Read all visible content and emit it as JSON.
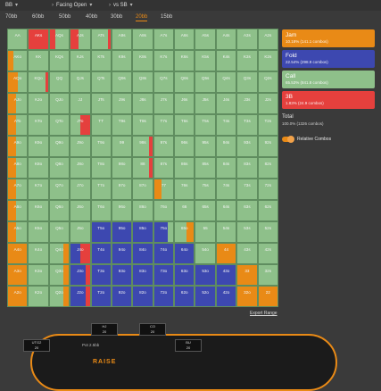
{
  "topbar": {
    "position": "BB",
    "situation": "Facing Open",
    "vs": "vs SB"
  },
  "stacks": [
    "70bb",
    "60bb",
    "50bb",
    "40bb",
    "30bb",
    "20bb",
    "15bb"
  ],
  "active_stack": "20bb",
  "colors": {
    "jam": "#e98a16",
    "fold": "#3d48b0",
    "call": "#8ec08a",
    "three_bet": "#e5403d",
    "accent": "#e98a16"
  },
  "actions": [
    {
      "key": "jam",
      "name": "Jam",
      "sub": "10.18% (141.1 combos)"
    },
    {
      "key": "fold",
      "name": "Fold",
      "sub": "22.54% (298.9 combos)"
    },
    {
      "key": "call",
      "name": "Call",
      "sub": "65.53% (841.8 combos)"
    },
    {
      "key": "three_bet",
      "name": "3B",
      "sub": "1.83% (24.9 combos)"
    }
  ],
  "total": {
    "label": "Total",
    "sub": "100.0% (1326 combos)"
  },
  "relative_combos_label": "Relative Combos",
  "export_label": "Export Range",
  "table": {
    "seats": [
      {
        "name": "HJ",
        "stack": "20"
      },
      {
        "name": "CO",
        "stack": "20"
      },
      {
        "name": "UTG2",
        "stack": "20"
      },
      {
        "name": "BU",
        "stack": "20"
      }
    ],
    "pot": "Pot 2.5bb",
    "logo": "RAISE"
  },
  "hands": [
    [
      "AA",
      "AKs",
      "AQs",
      "AJs",
      "ATs",
      "A9s",
      "A8s",
      "A7s",
      "A6s",
      "A5s",
      "A4s",
      "A3s",
      "A2s"
    ],
    [
      "AKo",
      "KK",
      "KQs",
      "KJs",
      "KTs",
      "K9s",
      "K8s",
      "K7s",
      "K6s",
      "K5s",
      "K4s",
      "K3s",
      "K2s"
    ],
    [
      "AQo",
      "KQo",
      "QQ",
      "QJs",
      "QTs",
      "Q9s",
      "Q8s",
      "Q7s",
      "Q6s",
      "Q5s",
      "Q4s",
      "Q3s",
      "Q2s"
    ],
    [
      "AJo",
      "KJo",
      "QJo",
      "JJ",
      "JTs",
      "J9s",
      "J8s",
      "J7s",
      "J6s",
      "J5s",
      "J4s",
      "J3s",
      "J2s"
    ],
    [
      "ATo",
      "KTo",
      "QTo",
      "JTo",
      "TT",
      "T9s",
      "T8s",
      "T7s",
      "T6s",
      "T5s",
      "T4s",
      "T3s",
      "T2s"
    ],
    [
      "A9o",
      "K9o",
      "Q9o",
      "J9o",
      "T9o",
      "99",
      "98s",
      "97s",
      "96s",
      "95s",
      "94s",
      "93s",
      "92s"
    ],
    [
      "A8o",
      "K8o",
      "Q8o",
      "J8o",
      "T8o",
      "98o",
      "88",
      "87s",
      "86s",
      "85s",
      "84s",
      "83s",
      "82s"
    ],
    [
      "A7o",
      "K7o",
      "Q7o",
      "J7o",
      "T7o",
      "97o",
      "87o",
      "77",
      "76s",
      "75s",
      "74s",
      "73s",
      "72s"
    ],
    [
      "A6o",
      "K6o",
      "Q6o",
      "J6o",
      "T6o",
      "96o",
      "86o",
      "76o",
      "66",
      "65s",
      "64s",
      "63s",
      "62s"
    ],
    [
      "A5o",
      "K5o",
      "Q5o",
      "J5o",
      "T5o",
      "95o",
      "85o",
      "75o",
      "65o",
      "55",
      "54s",
      "53s",
      "52s"
    ],
    [
      "A4o",
      "K4o",
      "Q4o",
      "J4o",
      "T4o",
      "94o",
      "84o",
      "74o",
      "64o",
      "54o",
      "44",
      "43s",
      "42s"
    ],
    [
      "A3o",
      "K3o",
      "Q3o",
      "J3o",
      "T3o",
      "93o",
      "83o",
      "73o",
      "63o",
      "53o",
      "43o",
      "33",
      "32s"
    ],
    [
      "A2o",
      "K2o",
      "Q2o",
      "J2o",
      "T2o",
      "92o",
      "82o",
      "72o",
      "62o",
      "52o",
      "42o",
      "32o",
      "22"
    ]
  ],
  "mix": [
    [
      [
        "c",
        1
      ],
      [
        "r",
        1
      ],
      [
        "r",
        0.3,
        "c",
        0.7
      ],
      [
        "r",
        0.4,
        "c",
        0.6
      ],
      [
        "c",
        0.85,
        "r",
        0.15
      ],
      [
        "c",
        1
      ],
      [
        "c",
        1
      ],
      [
        "c",
        1
      ],
      [
        "c",
        1
      ],
      [
        "c",
        1
      ],
      [
        "c",
        1
      ],
      [
        "c",
        1
      ],
      [
        "c",
        1
      ]
    ],
    [
      [
        "j",
        0.3,
        "c",
        0.7
      ],
      [
        "c",
        1
      ],
      [
        "c",
        1
      ],
      [
        "c",
        1
      ],
      [
        "c",
        1
      ],
      [
        "c",
        1
      ],
      [
        "c",
        1
      ],
      [
        "c",
        1
      ],
      [
        "c",
        1
      ],
      [
        "c",
        1
      ],
      [
        "c",
        1
      ],
      [
        "c",
        1
      ],
      [
        "c",
        1
      ]
    ],
    [
      [
        "j",
        0.5,
        "c",
        0.5
      ],
      [
        "c",
        0.85,
        "r",
        0.15
      ],
      [
        "c",
        1
      ],
      [
        "c",
        1
      ],
      [
        "c",
        1
      ],
      [
        "c",
        1
      ],
      [
        "c",
        1
      ],
      [
        "c",
        1
      ],
      [
        "c",
        1
      ],
      [
        "c",
        1
      ],
      [
        "c",
        1
      ],
      [
        "c",
        1
      ],
      [
        "c",
        1
      ]
    ],
    [
      [
        "j",
        0.4,
        "c",
        0.6
      ],
      [
        "c",
        1
      ],
      [
        "c",
        1
      ],
      [
        "c",
        1
      ],
      [
        "c",
        1
      ],
      [
        "c",
        1
      ],
      [
        "c",
        1
      ],
      [
        "c",
        1
      ],
      [
        "c",
        1
      ],
      [
        "c",
        1
      ],
      [
        "c",
        1
      ],
      [
        "c",
        1
      ],
      [
        "c",
        1
      ]
    ],
    [
      [
        "j",
        0.4,
        "c",
        0.6
      ],
      [
        "c",
        1
      ],
      [
        "c",
        1
      ],
      [
        "c",
        0.5,
        "r",
        0.5
      ],
      [
        "c",
        1
      ],
      [
        "c",
        1
      ],
      [
        "c",
        1
      ],
      [
        "c",
        1
      ],
      [
        "c",
        1
      ],
      [
        "c",
        1
      ],
      [
        "c",
        1
      ],
      [
        "c",
        1
      ],
      [
        "c",
        1
      ]
    ],
    [
      [
        "j",
        0.4,
        "c",
        0.6
      ],
      [
        "c",
        1
      ],
      [
        "c",
        1
      ],
      [
        "c",
        1
      ],
      [
        "c",
        1
      ],
      [
        "c",
        1
      ],
      [
        "c",
        0.85,
        "r",
        0.15
      ],
      [
        "c",
        1
      ],
      [
        "c",
        1
      ],
      [
        "c",
        1
      ],
      [
        "c",
        1
      ],
      [
        "c",
        1
      ],
      [
        "c",
        1
      ]
    ],
    [
      [
        "j",
        0.4,
        "c",
        0.6
      ],
      [
        "c",
        1
      ],
      [
        "c",
        1
      ],
      [
        "c",
        1
      ],
      [
        "c",
        1
      ],
      [
        "c",
        1
      ],
      [
        "c",
        0.85,
        "r",
        0.15
      ],
      [
        "c",
        1
      ],
      [
        "c",
        1
      ],
      [
        "c",
        1
      ],
      [
        "c",
        1
      ],
      [
        "c",
        1
      ],
      [
        "c",
        1
      ]
    ],
    [
      [
        "j",
        0.4,
        "c",
        0.6
      ],
      [
        "c",
        1
      ],
      [
        "c",
        1
      ],
      [
        "c",
        1
      ],
      [
        "c",
        1
      ],
      [
        "c",
        1
      ],
      [
        "c",
        1
      ],
      [
        "j",
        0.4,
        "c",
        0.6
      ],
      [
        "c",
        1
      ],
      [
        "c",
        1
      ],
      [
        "c",
        1
      ],
      [
        "c",
        1
      ],
      [
        "c",
        1
      ]
    ],
    [
      [
        "j",
        0.4,
        "c",
        0.6
      ],
      [
        "c",
        1
      ],
      [
        "c",
        1
      ],
      [
        "c",
        1
      ],
      [
        "c",
        1
      ],
      [
        "c",
        1
      ],
      [
        "c",
        1
      ],
      [
        "c",
        1
      ],
      [
        "c",
        1
      ],
      [
        "c",
        1
      ],
      [
        "c",
        1
      ],
      [
        "c",
        1
      ],
      [
        "c",
        1
      ]
    ],
    [
      [
        "j",
        0.4,
        "c",
        0.6
      ],
      [
        "c",
        1
      ],
      [
        "c",
        1
      ],
      [
        "c",
        1
      ],
      [
        "f",
        1
      ],
      [
        "f",
        1
      ],
      [
        "f",
        1
      ],
      [
        "f",
        0.7,
        "c",
        0.3
      ],
      [
        "c",
        0.6,
        "j",
        0.4
      ],
      [
        "c",
        1
      ],
      [
        "c",
        1
      ],
      [
        "c",
        1
      ],
      [
        "c",
        1
      ]
    ],
    [
      [
        "j",
        1
      ],
      [
        "c",
        1
      ],
      [
        "c",
        0.7,
        "j",
        0.3
      ],
      [
        "f",
        0.5,
        "r",
        0.5
      ],
      [
        "f",
        1
      ],
      [
        "f",
        1
      ],
      [
        "f",
        1
      ],
      [
        "f",
        1
      ],
      [
        "f",
        1
      ],
      [
        "c",
        1
      ],
      [
        "j",
        1
      ],
      [
        "c",
        1
      ],
      [
        "c",
        1
      ]
    ],
    [
      [
        "j",
        1
      ],
      [
        "c",
        1
      ],
      [
        "c",
        0.7,
        "j",
        0.3
      ],
      [
        "f",
        0.8,
        "r",
        0.2
      ],
      [
        "f",
        1
      ],
      [
        "f",
        1
      ],
      [
        "f",
        1
      ],
      [
        "f",
        1
      ],
      [
        "f",
        1
      ],
      [
        "f",
        1
      ],
      [
        "f",
        1
      ],
      [
        "j",
        1
      ],
      [
        "c",
        1
      ]
    ],
    [
      [
        "j",
        1
      ],
      [
        "c",
        1
      ],
      [
        "c",
        0.7,
        "j",
        0.3
      ],
      [
        "f",
        0.8,
        "r",
        0.2
      ],
      [
        "f",
        1
      ],
      [
        "f",
        1
      ],
      [
        "f",
        1
      ],
      [
        "f",
        1
      ],
      [
        "f",
        1
      ],
      [
        "f",
        1
      ],
      [
        "f",
        1
      ],
      [
        "j",
        1
      ],
      [
        "j",
        1
      ]
    ]
  ]
}
